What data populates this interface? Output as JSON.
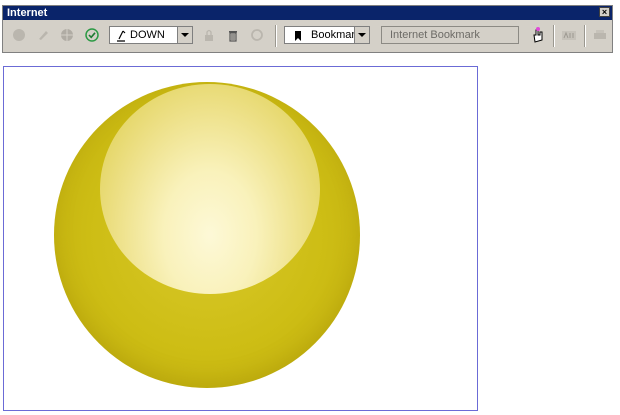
{
  "window": {
    "title": "Internet",
    "close_label": "×"
  },
  "toolbar": {
    "download_combo": {
      "value": "DOWN"
    },
    "bookmark_combo": {
      "value": "Bookmark"
    },
    "internet_bookmark": {
      "value": "Internet Bookmark"
    }
  },
  "icons": [
    "back-icon",
    "edit-icon",
    "globe-icon",
    "check-icon",
    "download-icon",
    "lock-icon",
    "trash-icon",
    "refresh-icon",
    "bookmark-icon",
    "hand-icon",
    "text-icon",
    "print-icon"
  ],
  "colors": {
    "titlebar": "#0a246a",
    "toolbar_bg": "#d4d0c8",
    "ball": "#cdbd14",
    "canvas_border": "#6b6bd6"
  }
}
